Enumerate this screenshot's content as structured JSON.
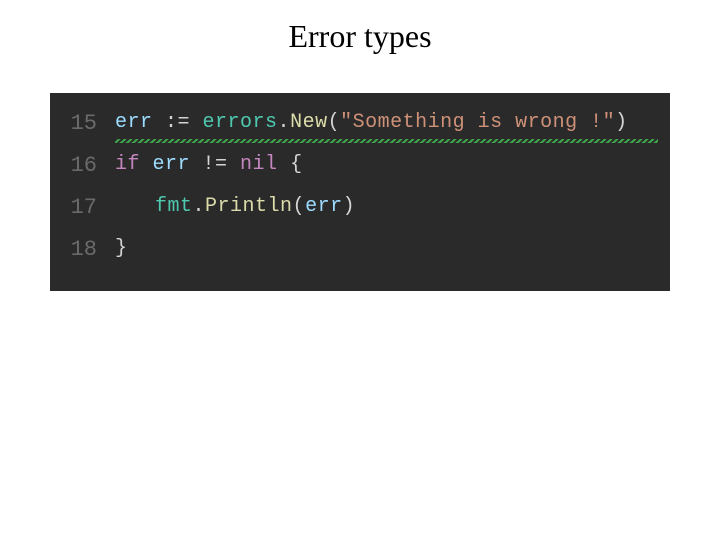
{
  "slide": {
    "title": "Error types"
  },
  "code": {
    "lines": [
      {
        "num": "15",
        "has_squiggle": true,
        "indent": "indent1"
      },
      {
        "num": "16",
        "has_squiggle": false,
        "indent": "indent1"
      },
      {
        "num": "17",
        "has_squiggle": false,
        "indent": "indent2"
      },
      {
        "num": "18",
        "has_squiggle": false,
        "indent": "indent1"
      }
    ],
    "l15": {
      "var": "err",
      "op": " := ",
      "pkg": "errors",
      "dot": ".",
      "fn": "New",
      "lp": "(",
      "str": "\"Something is wrong !\"",
      "rp": ")"
    },
    "l16": {
      "kw": "if ",
      "var": "err",
      "op": " != ",
      "nil": "nil",
      "brace": " {"
    },
    "l17": {
      "pkg": "fmt",
      "dot": ".",
      "fn": "Println",
      "lp": "(",
      "arg": "err",
      "rp": ")"
    },
    "l18": {
      "brace": "}"
    }
  }
}
